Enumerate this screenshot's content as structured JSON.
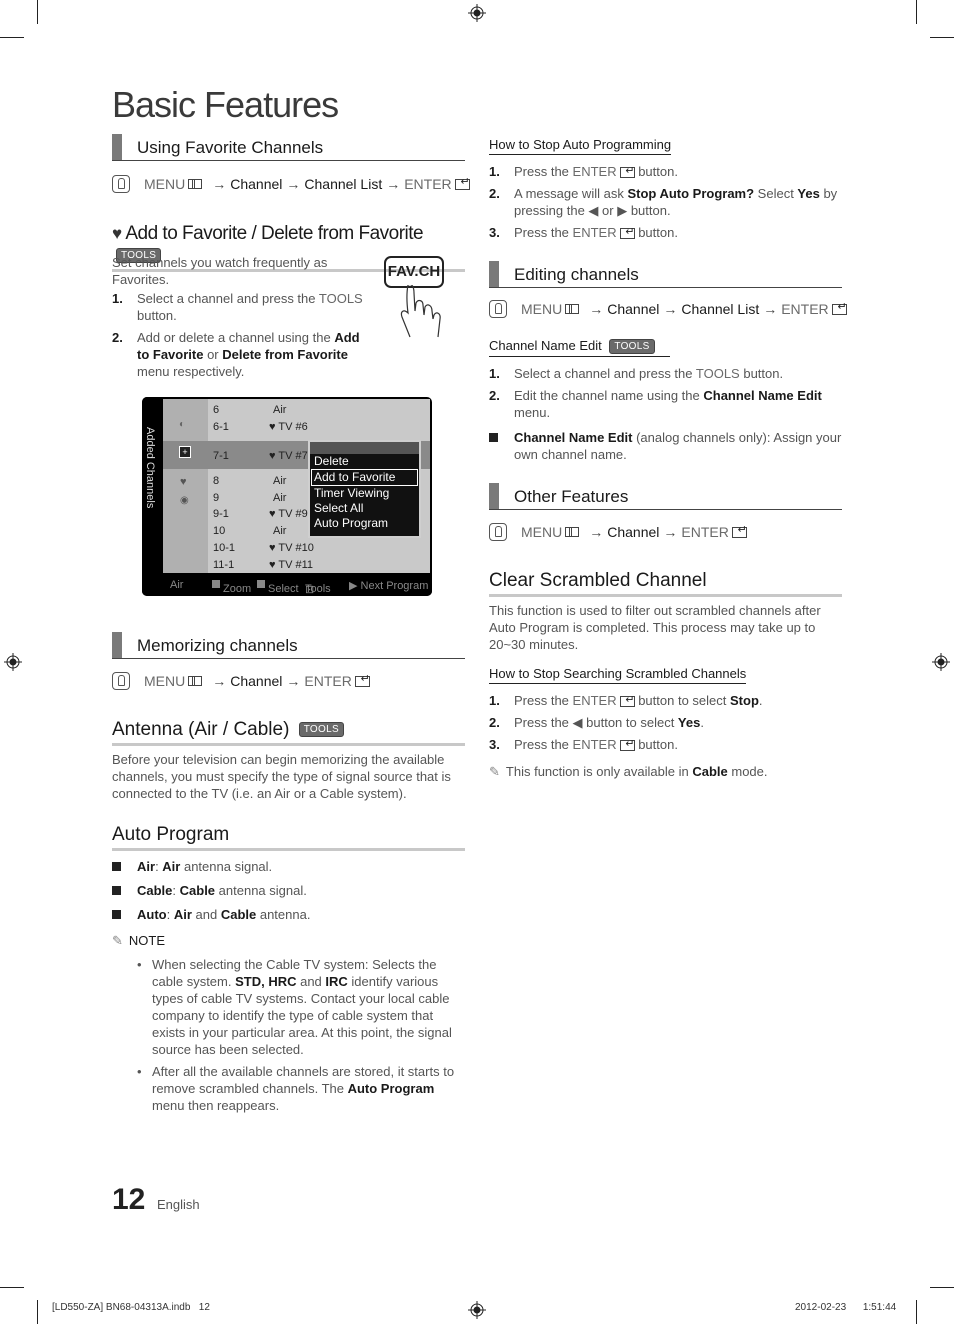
{
  "page": {
    "title": "Basic Features",
    "page_number": "12",
    "language": "English",
    "slug_left": "[LD550-ZA] BN68-04313A.indb   12",
    "slug_right": "2012-02-23      1:51:44"
  },
  "icons": {
    "remote_hand": "hand-pointer-icon",
    "menu": "menu-icon",
    "enter": "enter-icon",
    "tools": "tools-icon",
    "heart": "heart-icon",
    "note": "note-pencil-icon",
    "registration": "registration-mark-icon"
  },
  "left": {
    "using_fav": {
      "heading": "Using Favorite Channels",
      "path": [
        "MENU",
        "Channel",
        "Channel List",
        "ENTER"
      ]
    },
    "add_fav": {
      "heading": "Add to Favorite / Delete from Favorite",
      "badge": "TOOLS",
      "intro": "Set channels you watch frequently as Favorites.",
      "fav_button": "FAV.CH",
      "steps": [
        {
          "num": "1.",
          "pre": "Select a channel and press the ",
          "b1": "TOOLS",
          "mid": " button.",
          "b2": "",
          "mid2": "",
          "b3": "",
          "post": ""
        },
        {
          "num": "2.",
          "pre": "Add or delete a channel using the ",
          "b1": "Add to Favorite",
          "mid": " or ",
          "b2": "Delete from Favorite",
          "mid2": " menu respectively.",
          "b3": "",
          "post": ""
        }
      ]
    },
    "osd": {
      "side_label": "Added Channels",
      "rows": [
        {
          "ch": "6",
          "name": "Air"
        },
        {
          "ch": "6-1",
          "name": "♥ TV #6"
        },
        {
          "ch": "7-1",
          "name": "♥ TV #7"
        },
        {
          "ch": "8",
          "name": "Air"
        },
        {
          "ch": "9",
          "name": "Air"
        },
        {
          "ch": "9-1",
          "name": "♥ TV #9"
        },
        {
          "ch": "10",
          "name": "Air"
        },
        {
          "ch": "10-1",
          "name": "♥ TV #10"
        },
        {
          "ch": "11-1",
          "name": "♥ TV #11"
        }
      ],
      "menu": [
        "Delete",
        "Add to Favorite",
        "Timer Viewing",
        "Select All",
        "Auto Program"
      ],
      "menu_selected": "Add to Favorite",
      "footer": {
        "source": "Air",
        "zoom": "Zoom",
        "select": "Select",
        "tools": "Tools",
        "next": "▶ Next Program"
      }
    },
    "memorizing": {
      "heading": "Memorizing channels",
      "path": [
        "MENU",
        "Channel",
        "ENTER"
      ]
    },
    "antenna": {
      "heading": "Antenna (Air / Cable)",
      "badge": "TOOLS",
      "body": "Before your television can begin memorizing the available channels, you must specify the type of signal source that is connected to the TV (i.e. an Air or a Cable system)."
    },
    "auto_program": {
      "heading": "Auto Program",
      "items": [
        {
          "label": "Air",
          "b": "Air",
          "rest": " antenna signal."
        },
        {
          "label": "Cable",
          "b": "Cable",
          "rest": " antenna signal."
        },
        {
          "label": "Auto",
          "b": "Air",
          "mid": " and ",
          "b2": "Cable",
          "rest": " antenna."
        }
      ],
      "note_label": "NOTE",
      "notes": [
        "When selecting the Cable TV system: Selects the cable system. STD, HRC and IRC identify various types of cable TV systems. Contact your local cable company to identify the type of cable system that exists in your particular area. At this point, the signal source has been selected.",
        "After all the available channels are stored, it starts to remove scrambled channels. The Auto Program menu then reappears."
      ]
    }
  },
  "right": {
    "stop_auto": {
      "heading": "How to Stop Auto Programming",
      "steps": [
        "Press the ENTER button.",
        "A message will ask Stop Auto Program? Select Yes by pressing the ◀ or ▶ button.",
        "Press the ENTER button."
      ]
    },
    "editing": {
      "heading": "Editing channels",
      "path": [
        "MENU",
        "Channel",
        "Channel List",
        "ENTER"
      ],
      "sub_heading": "Channel Name Edit",
      "badge": "TOOLS",
      "steps": [
        "Select a channel and press the TOOLS button.",
        "Edit the channel name using the Channel Name Edit menu."
      ],
      "bullet": "Channel Name Edit (analog channels only): Assign your own channel name."
    },
    "other": {
      "heading": "Other Features",
      "path": [
        "MENU",
        "Channel",
        "ENTER"
      ]
    },
    "clear_scrambled": {
      "heading": "Clear Scrambled Channel",
      "body": "This function is used to filter out scrambled channels after Auto Program is completed. This process may take up to 20~30 minutes.",
      "sub_heading": "How to Stop Searching Scrambled Channels",
      "steps": [
        "Press the ENTER button to select Stop.",
        "Press the ◀ button to select Yes.",
        "Press the ENTER button."
      ],
      "note": "This function is only available in Cable mode."
    }
  }
}
